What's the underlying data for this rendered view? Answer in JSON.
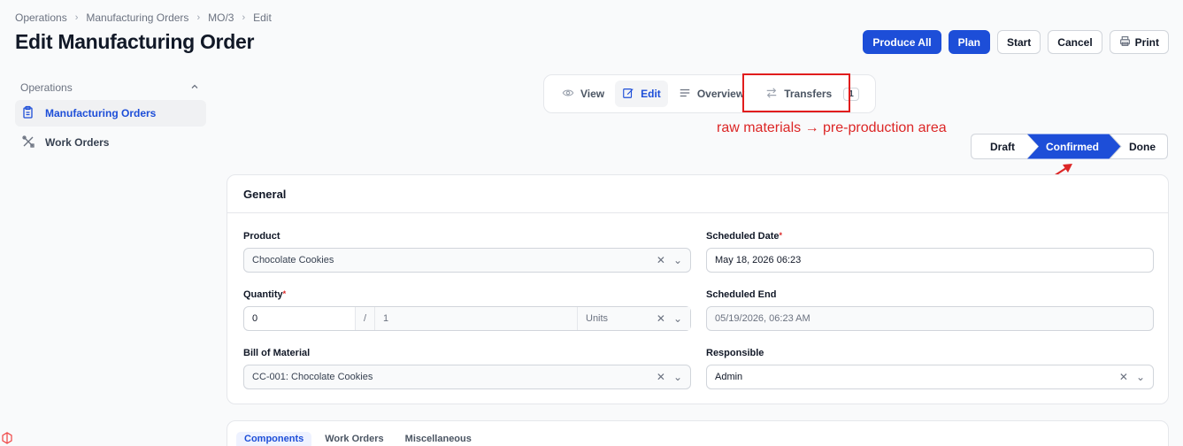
{
  "breadcrumb": [
    "Operations",
    "Manufacturing Orders",
    "MO/3",
    "Edit"
  ],
  "page_title": "Edit Manufacturing Order",
  "actions": {
    "produce_all": "Produce All",
    "plan": "Plan",
    "start": "Start",
    "cancel": "Cancel",
    "print": "Print"
  },
  "sidebar": {
    "group": "Operations",
    "items": [
      {
        "label": "Manufacturing Orders",
        "icon": "clipboard-icon"
      },
      {
        "label": "Work Orders",
        "icon": "tools-icon"
      }
    ]
  },
  "tabs": [
    {
      "label": "View",
      "icon": "eye-icon"
    },
    {
      "label": "Edit",
      "icon": "pencil-icon"
    },
    {
      "label": "Overview",
      "icon": "lines-icon"
    },
    {
      "label": "Transfers",
      "icon": "arrows-icon",
      "count": "1"
    }
  ],
  "annotation": "raw materials → pre-production area",
  "status": {
    "steps": [
      "Draft",
      "Confirmed",
      "Done"
    ],
    "active": "Confirmed"
  },
  "general": {
    "title": "General",
    "product_label": "Product",
    "product_value": "Chocolate Cookies",
    "quantity_label": "Quantity",
    "quantity_value": "0",
    "quantity_sep": "/",
    "quantity_total": "1",
    "quantity_unit": "Units",
    "bom_label": "Bill of Material",
    "bom_value": "CC-001: Chocolate Cookies",
    "scheduled_date_label": "Scheduled Date",
    "scheduled_date_value": "May 18, 2026 06:23",
    "scheduled_end_label": "Scheduled End",
    "scheduled_end_value": "05/19/2026, 06:23 AM",
    "responsible_label": "Responsible",
    "responsible_value": "Admin"
  },
  "bottom_tabs": [
    "Components",
    "Work Orders",
    "Miscellaneous"
  ],
  "colors": {
    "primary": "#1d4ed8",
    "annotation": "#dc2626"
  }
}
